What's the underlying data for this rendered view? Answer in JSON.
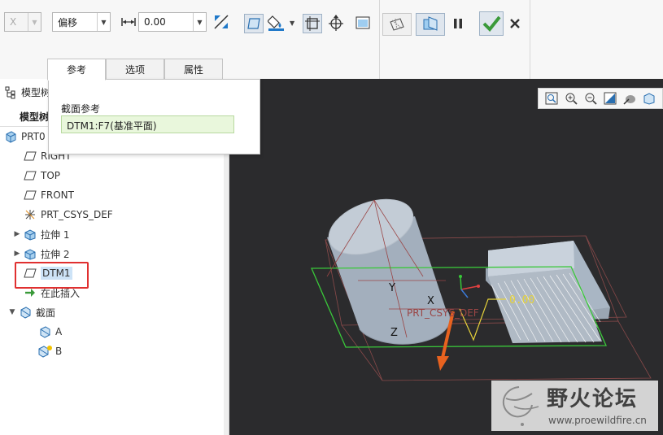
{
  "ribbon": {
    "dir_combo": "X",
    "type_combo": "偏移",
    "offset_value": "0.00"
  },
  "tabs": [
    {
      "label": "参考",
      "active": true
    },
    {
      "label": "选项",
      "active": false
    },
    {
      "label": "属性",
      "active": false
    }
  ],
  "popup": {
    "section_label": "截面参考",
    "reference_value": "DTM1:F7(基准平面)"
  },
  "model_tree": {
    "header": "模型树",
    "subheader": "模型树",
    "root": "PRT0",
    "items": [
      {
        "label": "RIGHT",
        "icon": "datum-plane-icon"
      },
      {
        "label": "TOP",
        "icon": "datum-plane-icon"
      },
      {
        "label": "FRONT",
        "icon": "datum-plane-icon"
      },
      {
        "label": "PRT_CSYS_DEF",
        "icon": "csys-icon"
      },
      {
        "label": "拉伸 1",
        "icon": "extrude-icon"
      },
      {
        "label": "拉伸 2",
        "icon": "extrude-icon"
      },
      {
        "label": "DTM1",
        "icon": "datum-plane-icon",
        "selected": true
      },
      {
        "label": "在此插入",
        "icon": "insert-arrow-icon"
      },
      {
        "label": "截面",
        "icon": "section-icon"
      },
      {
        "label": "A",
        "icon": "section-icon"
      },
      {
        "label": "B",
        "icon": "section-new-icon"
      }
    ]
  },
  "viewport": {
    "labels": {
      "y": "Y",
      "x": "X",
      "z": "Z",
      "csys": "PRT_CSYS_DEF",
      "offset": "0.00"
    }
  },
  "watermark": {
    "title": "野火论坛",
    "url": "www.proewildfire.cn"
  },
  "colors": {
    "accent_green": "#3a9a3a",
    "highlight_red": "#e03030",
    "arrow_orange": "#e8621f",
    "viewport_bg": "#2b2b2d"
  }
}
